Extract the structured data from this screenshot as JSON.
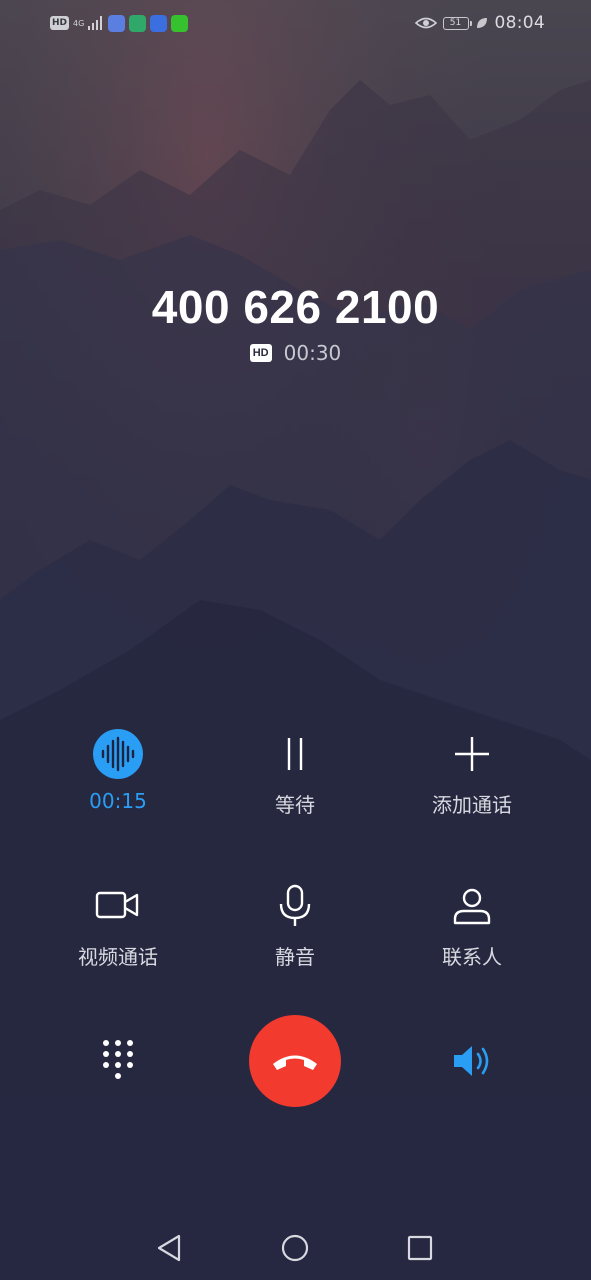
{
  "status_bar": {
    "hd_label": "HD",
    "network_label": "4G",
    "battery_level": "51",
    "time": "08:04",
    "app_icons": [
      "music-app-icon",
      "map-app-icon",
      "baidu-app-icon",
      "iqiyi-app-icon"
    ]
  },
  "call": {
    "number": "400 626 2100",
    "hd_badge": "HD",
    "duration": "00:30"
  },
  "actions": {
    "recording": {
      "label": "00:15",
      "icon": "voice-wave-icon"
    },
    "hold": {
      "label": "等待",
      "icon": "pause-icon"
    },
    "add_call": {
      "label": "添加通话",
      "icon": "plus-icon"
    },
    "video_call": {
      "label": "视频通话",
      "icon": "video-camera-icon"
    },
    "mute": {
      "label": "静音",
      "icon": "microphone-icon"
    },
    "contacts": {
      "label": "联系人",
      "icon": "person-icon"
    }
  },
  "controls": {
    "dialpad_icon": "dialpad-icon",
    "end_call_icon": "end-call-icon",
    "speaker_icon": "speaker-icon"
  },
  "nav": {
    "back_icon": "back-icon",
    "home_icon": "home-icon",
    "recents_icon": "recents-icon"
  },
  "colors": {
    "accent_blue": "#2a9df4",
    "end_call_red": "#f23a2f",
    "background_dark": "#23253d",
    "app_music": "#5a7fe0",
    "app_map": "#2fa86a",
    "app_baidu": "#3b6fe0",
    "app_iqiyi": "#36c22f"
  }
}
